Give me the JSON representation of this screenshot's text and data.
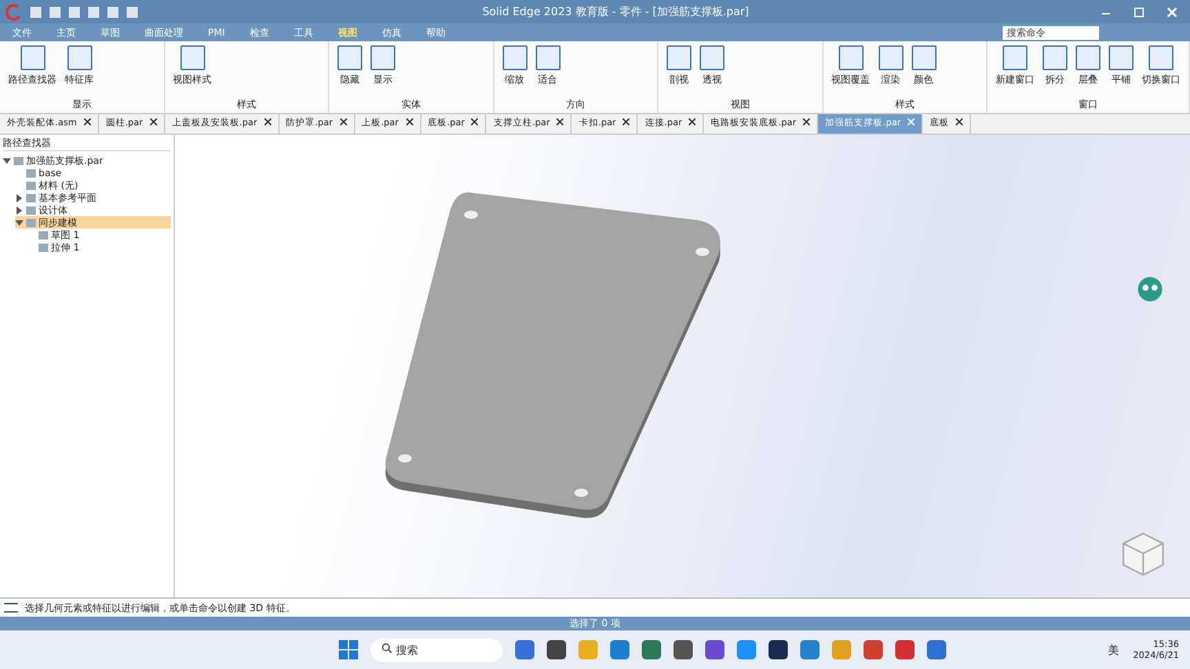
{
  "window": {
    "title": "Solid Edge 2023 教育版 - 零件 - [加强筋支撑板.par]",
    "search_placeholder": "搜索命令"
  },
  "menu": [
    {
      "label": "文件",
      "selected": false
    },
    {
      "label": "主页",
      "selected": false
    },
    {
      "label": "草图",
      "selected": false
    },
    {
      "label": "曲面处理",
      "selected": false
    },
    {
      "label": "PMI",
      "selected": false
    },
    {
      "label": "检查",
      "selected": false
    },
    {
      "label": "工具",
      "selected": false
    },
    {
      "label": "视图",
      "selected": true
    },
    {
      "label": "仿真",
      "selected": false
    },
    {
      "label": "帮助",
      "selected": false
    }
  ],
  "ribbon": [
    {
      "label": "显示",
      "buttons": [
        "路径查找器",
        "特征库"
      ]
    },
    {
      "label": "样式",
      "buttons": [
        "视图样式"
      ]
    },
    {
      "label": "实体",
      "buttons": [
        "隐藏",
        "显示"
      ]
    },
    {
      "label": "方向",
      "buttons": [
        "缩放",
        "适合"
      ]
    },
    {
      "label": "视图",
      "buttons": [
        "剖视",
        "透视"
      ]
    },
    {
      "label": "样式",
      "buttons": [
        "视图覆盖",
        "渲染",
        "颜色"
      ]
    },
    {
      "label": "窗口",
      "buttons": [
        "新建窗口",
        "拆分",
        "层叠",
        "平铺",
        "切换窗口"
      ]
    }
  ],
  "doc_tabs": [
    {
      "label": "外壳装配体.asm",
      "selected": false
    },
    {
      "label": "圆柱.par",
      "selected": false
    },
    {
      "label": "上盖板及安装板.par",
      "selected": false
    },
    {
      "label": "防护罩.par",
      "selected": false
    },
    {
      "label": "上板.par",
      "selected": false
    },
    {
      "label": "底板.par",
      "selected": false
    },
    {
      "label": "支撑立柱.par",
      "selected": false
    },
    {
      "label": "卡扣.par",
      "selected": false
    },
    {
      "label": "连接.par",
      "selected": false
    },
    {
      "label": "电路板安装底板.par",
      "selected": false
    },
    {
      "label": "加强筋支撑板.par",
      "selected": true
    },
    {
      "label": "底板",
      "selected": false
    }
  ],
  "pathfinder": {
    "title": "路径查找器",
    "tree": [
      {
        "label": "加强筋支撑板.par",
        "expanded": true,
        "selected": false,
        "children": [
          {
            "label": "base",
            "selected": false
          },
          {
            "label": "材料 (无)",
            "selected": false
          },
          {
            "label": "基本参考平面",
            "expanded": false,
            "selected": false
          },
          {
            "label": "设计体",
            "expanded": false,
            "selected": false
          },
          {
            "label": "同步建模",
            "expanded": true,
            "selected": true,
            "children": [
              {
                "label": "草图 1",
                "selected": false
              },
              {
                "label": "拉伸 1",
                "selected": false
              }
            ]
          }
        ]
      }
    ]
  },
  "prompt": "选择几何元素或特征以进行编辑，或单击命令以创建 3D 特征。",
  "status": "选择了 0 项",
  "taskbar": {
    "search_placeholder": "搜索",
    "ime": "美",
    "time": "15:36",
    "date": "2024/6/21"
  }
}
